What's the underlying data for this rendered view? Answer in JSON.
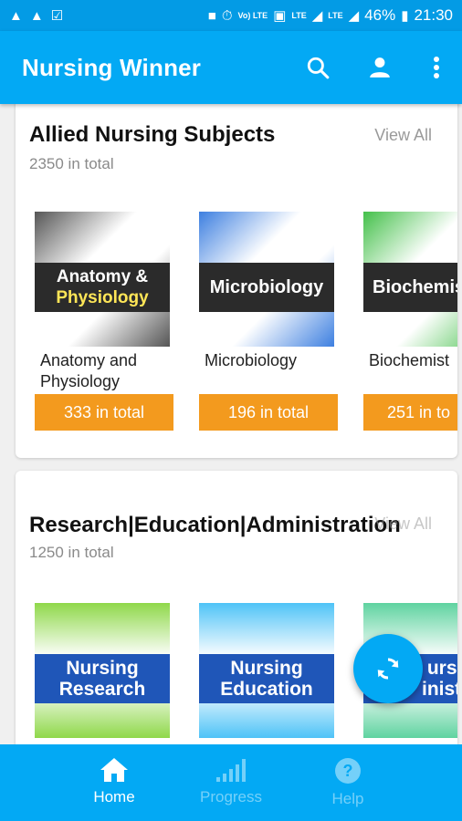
{
  "status_bar": {
    "battery": "46%",
    "time": "21:30",
    "volte": "Vo) LTE",
    "lte1": "LTE",
    "lte2": "LTE"
  },
  "app_bar": {
    "title": "Nursing Winner",
    "icons": [
      "search-icon",
      "account-icon",
      "more-vert-icon"
    ]
  },
  "sections": [
    {
      "title": "Allied Nursing Subjects",
      "count": "2350 in total",
      "view_all": "View All",
      "items": [
        {
          "thumb_label_1": "Anatomy &",
          "thumb_label_2": "Physiology",
          "name_line1": "Anatomy and",
          "name_line2": "Physiology",
          "count": "333 in total"
        },
        {
          "thumb_label_1": "Microbiology",
          "name_line1": "",
          "name_line2": "Microbiology",
          "count": "196 in total"
        },
        {
          "thumb_label_1": "Biochemis",
          "name_line1": "",
          "name_line2": "Biochemist",
          "count": "251 in to"
        }
      ]
    },
    {
      "title": "Research|Education|Administration",
      "count": "1250 in total",
      "view_all": "View All",
      "items": [
        {
          "thumb_label_1": "Nursing",
          "thumb_label_2": "Research"
        },
        {
          "thumb_label_1": "Nursing",
          "thumb_label_2": "Education"
        },
        {
          "thumb_label_1": "ursin",
          "thumb_label_2": "inistra"
        }
      ]
    }
  ],
  "fab": {
    "icon": "sync-icon"
  },
  "bottom_nav": [
    {
      "label": "Home",
      "icon": "home-icon",
      "active": true
    },
    {
      "label": "Progress",
      "icon": "signal-bars-icon",
      "active": false
    },
    {
      "label": "Help",
      "icon": "help-icon",
      "active": false
    }
  ],
  "colors": {
    "primary": "#03a9f4",
    "status_bar": "#039be5",
    "accent_orange": "#f39a1e",
    "thumb_dark_band": "#2b2b2b",
    "thumb_blue_band": "#1f56b8"
  }
}
